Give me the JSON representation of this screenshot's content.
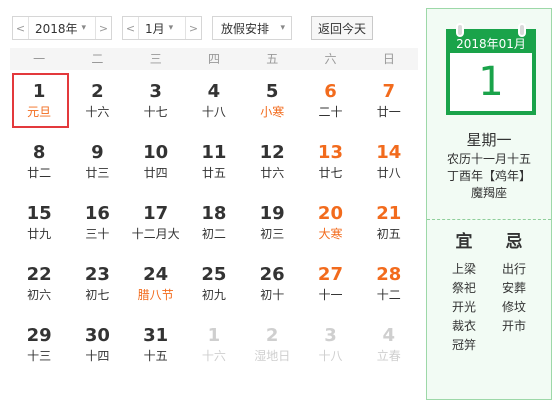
{
  "toolbar": {
    "year_label": "2018年",
    "month_label": "1月",
    "holiday_label": "放假安排",
    "today_label": "返回今天",
    "prev_arrow": "<",
    "next_arrow": ">",
    "caret": "▾"
  },
  "weekdays": [
    "一",
    "二",
    "三",
    "四",
    "五",
    "六",
    "日"
  ],
  "days": [
    {
      "num": "1",
      "lunar": "元旦",
      "festival": true,
      "weekend": false,
      "other": false,
      "selected": true
    },
    {
      "num": "2",
      "lunar": "十六",
      "festival": false,
      "weekend": false,
      "other": false,
      "selected": false
    },
    {
      "num": "3",
      "lunar": "十七",
      "festival": false,
      "weekend": false,
      "other": false,
      "selected": false
    },
    {
      "num": "4",
      "lunar": "十八",
      "festival": false,
      "weekend": false,
      "other": false,
      "selected": false
    },
    {
      "num": "5",
      "lunar": "小寒",
      "festival": true,
      "weekend": false,
      "other": false,
      "selected": false
    },
    {
      "num": "6",
      "lunar": "二十",
      "festival": false,
      "weekend": true,
      "other": false,
      "selected": false
    },
    {
      "num": "7",
      "lunar": "廿一",
      "festival": false,
      "weekend": true,
      "other": false,
      "selected": false
    },
    {
      "num": "8",
      "lunar": "廿二",
      "festival": false,
      "weekend": false,
      "other": false,
      "selected": false
    },
    {
      "num": "9",
      "lunar": "廿三",
      "festival": false,
      "weekend": false,
      "other": false,
      "selected": false
    },
    {
      "num": "10",
      "lunar": "廿四",
      "festival": false,
      "weekend": false,
      "other": false,
      "selected": false
    },
    {
      "num": "11",
      "lunar": "廿五",
      "festival": false,
      "weekend": false,
      "other": false,
      "selected": false
    },
    {
      "num": "12",
      "lunar": "廿六",
      "festival": false,
      "weekend": false,
      "other": false,
      "selected": false
    },
    {
      "num": "13",
      "lunar": "廿七",
      "festival": false,
      "weekend": true,
      "other": false,
      "selected": false
    },
    {
      "num": "14",
      "lunar": "廿八",
      "festival": false,
      "weekend": true,
      "other": false,
      "selected": false
    },
    {
      "num": "15",
      "lunar": "廿九",
      "festival": false,
      "weekend": false,
      "other": false,
      "selected": false
    },
    {
      "num": "16",
      "lunar": "三十",
      "festival": false,
      "weekend": false,
      "other": false,
      "selected": false
    },
    {
      "num": "17",
      "lunar": "十二月大",
      "festival": false,
      "weekend": false,
      "other": false,
      "selected": false
    },
    {
      "num": "18",
      "lunar": "初二",
      "festival": false,
      "weekend": false,
      "other": false,
      "selected": false
    },
    {
      "num": "19",
      "lunar": "初三",
      "festival": false,
      "weekend": false,
      "other": false,
      "selected": false
    },
    {
      "num": "20",
      "lunar": "大寒",
      "festival": true,
      "weekend": true,
      "other": false,
      "selected": false
    },
    {
      "num": "21",
      "lunar": "初五",
      "festival": false,
      "weekend": true,
      "other": false,
      "selected": false
    },
    {
      "num": "22",
      "lunar": "初六",
      "festival": false,
      "weekend": false,
      "other": false,
      "selected": false
    },
    {
      "num": "23",
      "lunar": "初七",
      "festival": false,
      "weekend": false,
      "other": false,
      "selected": false
    },
    {
      "num": "24",
      "lunar": "腊八节",
      "festival": true,
      "weekend": false,
      "other": false,
      "selected": false
    },
    {
      "num": "25",
      "lunar": "初九",
      "festival": false,
      "weekend": false,
      "other": false,
      "selected": false
    },
    {
      "num": "26",
      "lunar": "初十",
      "festival": false,
      "weekend": false,
      "other": false,
      "selected": false
    },
    {
      "num": "27",
      "lunar": "十一",
      "festival": false,
      "weekend": true,
      "other": false,
      "selected": false
    },
    {
      "num": "28",
      "lunar": "十二",
      "festival": false,
      "weekend": true,
      "other": false,
      "selected": false
    },
    {
      "num": "29",
      "lunar": "十三",
      "festival": false,
      "weekend": false,
      "other": false,
      "selected": false
    },
    {
      "num": "30",
      "lunar": "十四",
      "festival": false,
      "weekend": false,
      "other": false,
      "selected": false
    },
    {
      "num": "31",
      "lunar": "十五",
      "festival": false,
      "weekend": false,
      "other": false,
      "selected": false
    },
    {
      "num": "1",
      "lunar": "十六",
      "festival": false,
      "weekend": false,
      "other": true,
      "selected": false
    },
    {
      "num": "2",
      "lunar": "湿地日",
      "festival": false,
      "weekend": false,
      "other": true,
      "selected": false
    },
    {
      "num": "3",
      "lunar": "十八",
      "festival": false,
      "weekend": false,
      "other": true,
      "selected": false
    },
    {
      "num": "4",
      "lunar": "立春",
      "festival": false,
      "weekend": false,
      "other": true,
      "selected": false
    }
  ],
  "side": {
    "year_month": "2018年01月",
    "day": "1",
    "weekday": "星期一",
    "lunar_date": "农历十一月十五",
    "ganzhi": "丁酉年【鸡年】",
    "constellation": "魔羯座",
    "yi_label": "宜",
    "ji_label": "忌",
    "yi_items": [
      "上梁",
      "祭祀",
      "开光",
      "裁衣",
      "冠笄"
    ],
    "ji_items": [
      "出行",
      "安葬",
      "修坟",
      "开市"
    ]
  },
  "colors": {
    "accent_green": "#1aa34a",
    "weekend_orange": "#f26b1d",
    "selected_red": "#e3393c",
    "muted_gray": "#cfcfcf"
  }
}
